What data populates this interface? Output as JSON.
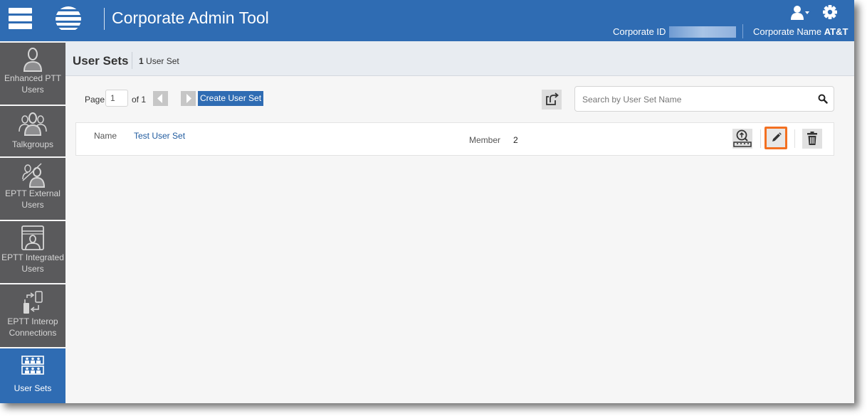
{
  "header": {
    "app_title": "Corporate Admin Tool",
    "corporate_id_label": "Corporate ID",
    "corporate_id_value": "",
    "corporate_name_label": "Corporate Name",
    "corporate_name_value": "AT&T",
    "icons": [
      "menu-icon",
      "att-logo",
      "user-menu-icon",
      "settings-gear-icon"
    ],
    "brand_color": "#2f6cb3"
  },
  "sidebar": {
    "items": [
      {
        "label": "Enhanced PTT Users",
        "icon": "user-icon",
        "active": false
      },
      {
        "label": "Talkgroups",
        "icon": "group-icon",
        "active": false
      },
      {
        "label": "EPTT External Users",
        "icon": "external-user-icon",
        "active": false
      },
      {
        "label": "EPTT Integrated Users",
        "icon": "integrated-user-icon",
        "active": false
      },
      {
        "label": "EPTT Interop Connections",
        "icon": "interop-icon",
        "active": false
      },
      {
        "label": "User Sets",
        "icon": "user-sets-icon",
        "active": true
      }
    ]
  },
  "subheader": {
    "title": "User Sets",
    "count_number": "1",
    "count_label": "User Set"
  },
  "toolbar": {
    "page_label": "Page",
    "page_value": "1",
    "of_label": "of 1",
    "create_label": "Create User Set",
    "search_placeholder": "Search by User Set Name",
    "search_value": ""
  },
  "user_sets": [
    {
      "name_label": "Name",
      "name": "Test User Set",
      "member_label": "Member",
      "member_count": "2",
      "actions": [
        "find-users-icon",
        "edit-icon",
        "delete-icon"
      ],
      "highlighted_action": "edit-icon"
    }
  ],
  "colors": {
    "highlight": "#f37021",
    "sidebar_bg": "#5a5a5c",
    "active_bg": "#2f6cb3",
    "link": "#1f5a9e"
  }
}
